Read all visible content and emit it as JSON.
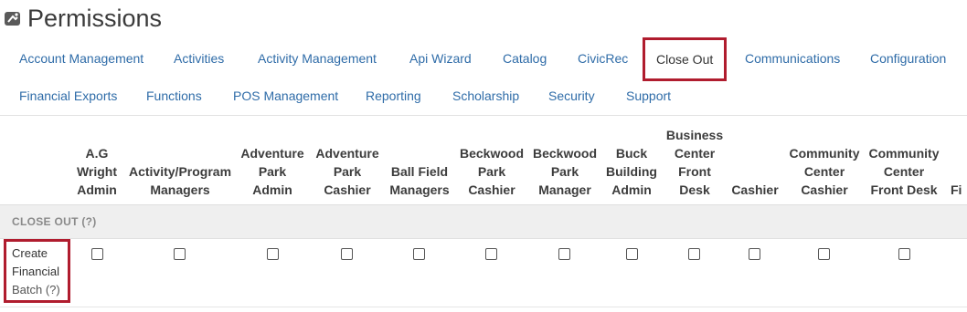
{
  "page": {
    "title": "Permissions",
    "title_icon": "permissions-icon"
  },
  "nav": {
    "row1": [
      {
        "label": "Account Management",
        "selected": false
      },
      {
        "label": "Activities",
        "selected": false
      },
      {
        "label": "Activity Management",
        "selected": false
      },
      {
        "label": "Api Wizard",
        "selected": false
      },
      {
        "label": "Catalog",
        "selected": false
      },
      {
        "label": "CivicRec",
        "selected": false
      },
      {
        "label": "Close Out",
        "selected": true
      },
      {
        "label": "Communications",
        "selected": false
      },
      {
        "label": "Configuration",
        "selected": false
      }
    ],
    "row2": [
      {
        "label": "Financial Exports",
        "selected": false
      },
      {
        "label": "Functions",
        "selected": false
      },
      {
        "label": "POS Management",
        "selected": false
      },
      {
        "label": "Reporting",
        "selected": false
      },
      {
        "label": "Scholarship",
        "selected": false
      },
      {
        "label": "Security",
        "selected": false
      },
      {
        "label": "Support",
        "selected": false
      }
    ]
  },
  "columns": [
    "A.G\nWright\nAdmin",
    "Activity/Program\nManagers",
    "Adventure\nPark\nAdmin",
    "Adventure\nPark\nCashier",
    "Ball Field\nManagers",
    "Beckwood\nPark\nCashier",
    "Beckwood\nPark\nManager",
    "Buck\nBuilding\nAdmin",
    "Business\nCenter\nFront\nDesk",
    "Cashier",
    "Community\nCenter\nCashier",
    "Community\nCenter\nFront Desk",
    "Fi"
  ],
  "section": {
    "label": "CLOSE OUT (?)"
  },
  "rows": [
    {
      "label_lines": [
        "Create",
        "Financial",
        "Batch (?)"
      ],
      "checked": [
        false,
        false,
        false,
        false,
        false,
        false,
        false,
        false,
        false,
        false,
        false,
        false
      ]
    }
  ],
  "colors": {
    "link": "#2f6ca8",
    "highlight_border": "#b01c2e",
    "section_bg": "#efefef"
  }
}
